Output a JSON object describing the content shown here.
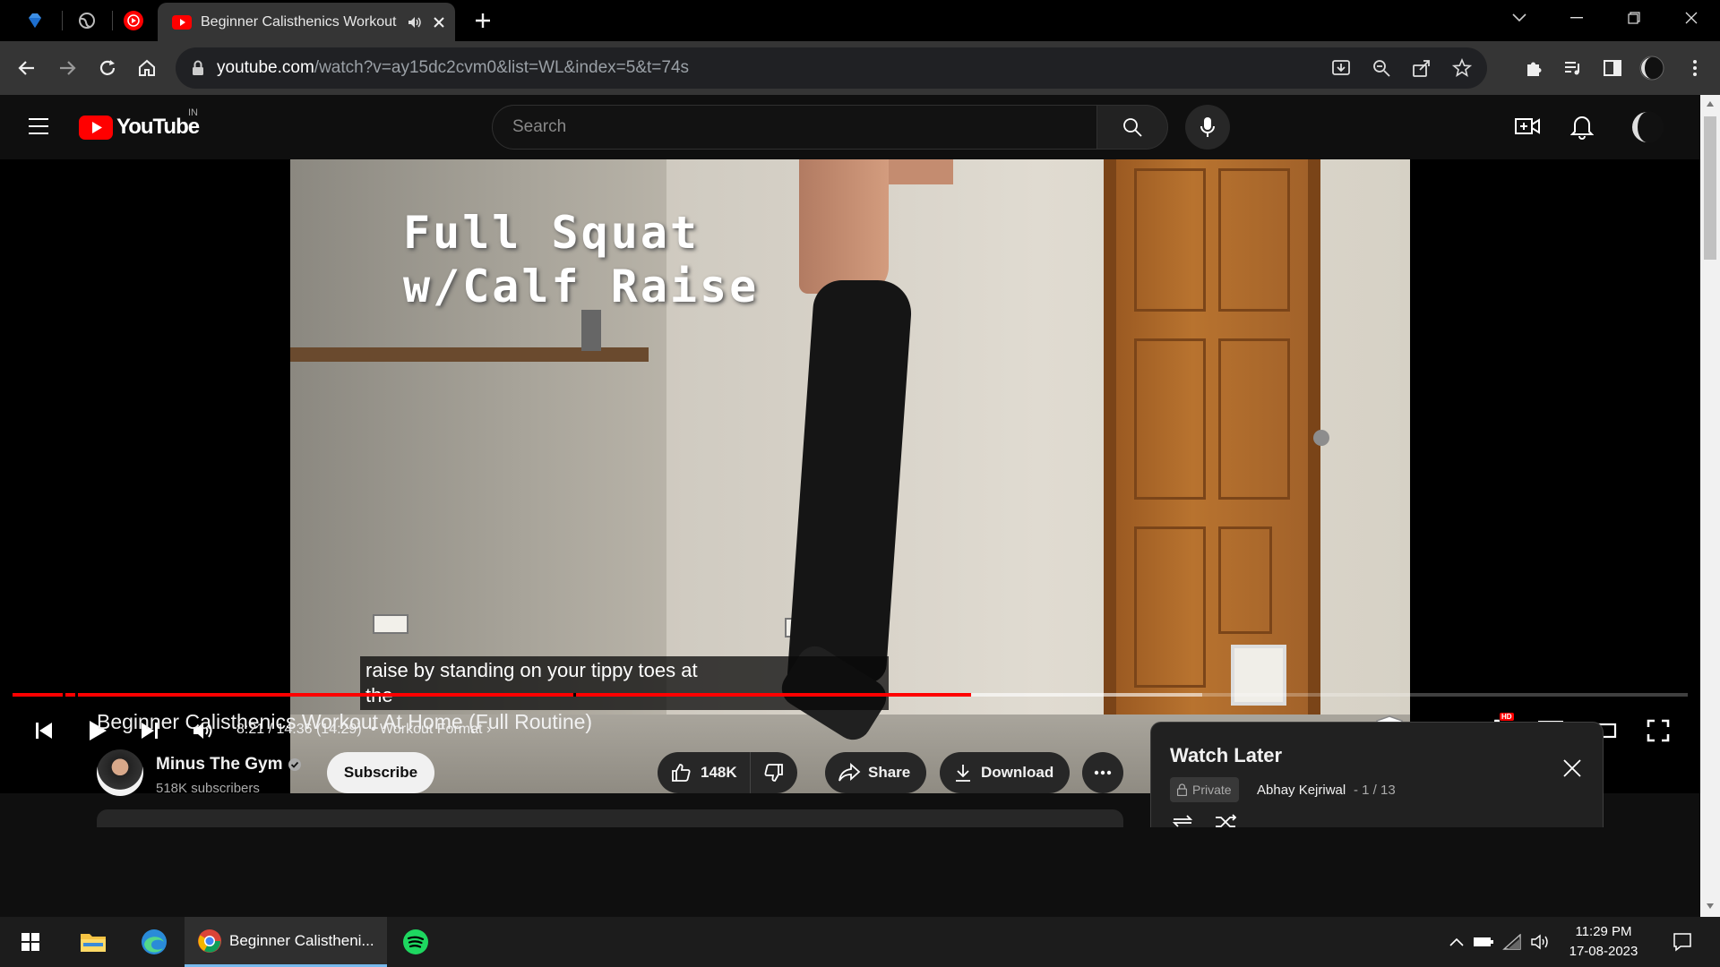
{
  "browser": {
    "tab_title": "Beginner Calisthenics Workout At Home (Full Routine)",
    "url_host": "youtube.com",
    "url_path": "/watch?v=ay15dc2cvm0&list=WL&index=5&t=74s"
  },
  "youtube": {
    "logo_text": "YouTube",
    "region": "IN",
    "search_placeholder": "Search"
  },
  "player": {
    "overlay_title_line1": "Full Squat",
    "overlay_title_line2": "w/Calf Raise",
    "caption_line1": "raise by standing on your tippy toes at",
    "caption_line2": "the",
    "time_display": "8:21 / 14:36 (14:29)",
    "chapter_label": "• Workout Format",
    "progress_fraction": 0.572,
    "buffer_fraction": 0.71,
    "hd_badge": "HD"
  },
  "video": {
    "title": "Beginner Calisthenics Workout At Home (Full Routine)",
    "channel": "Minus The Gym",
    "subscribers": "518K subscribers",
    "subscribe_label": "Subscribe",
    "likes": "148K",
    "share_label": "Share",
    "download_label": "Download"
  },
  "watch_later": {
    "title": "Watch Later",
    "privacy": "Private",
    "owner": "Abhay Kejriwal",
    "position": "- 1 / 13"
  },
  "taskbar": {
    "chrome_label": "Beginner Calistheni...",
    "time": "11:29 PM",
    "date": "17-08-2023"
  },
  "colors": {
    "youtube_red": "#ff0000",
    "background": "#0f0f0f",
    "chrome_toolbar": "#353535"
  }
}
